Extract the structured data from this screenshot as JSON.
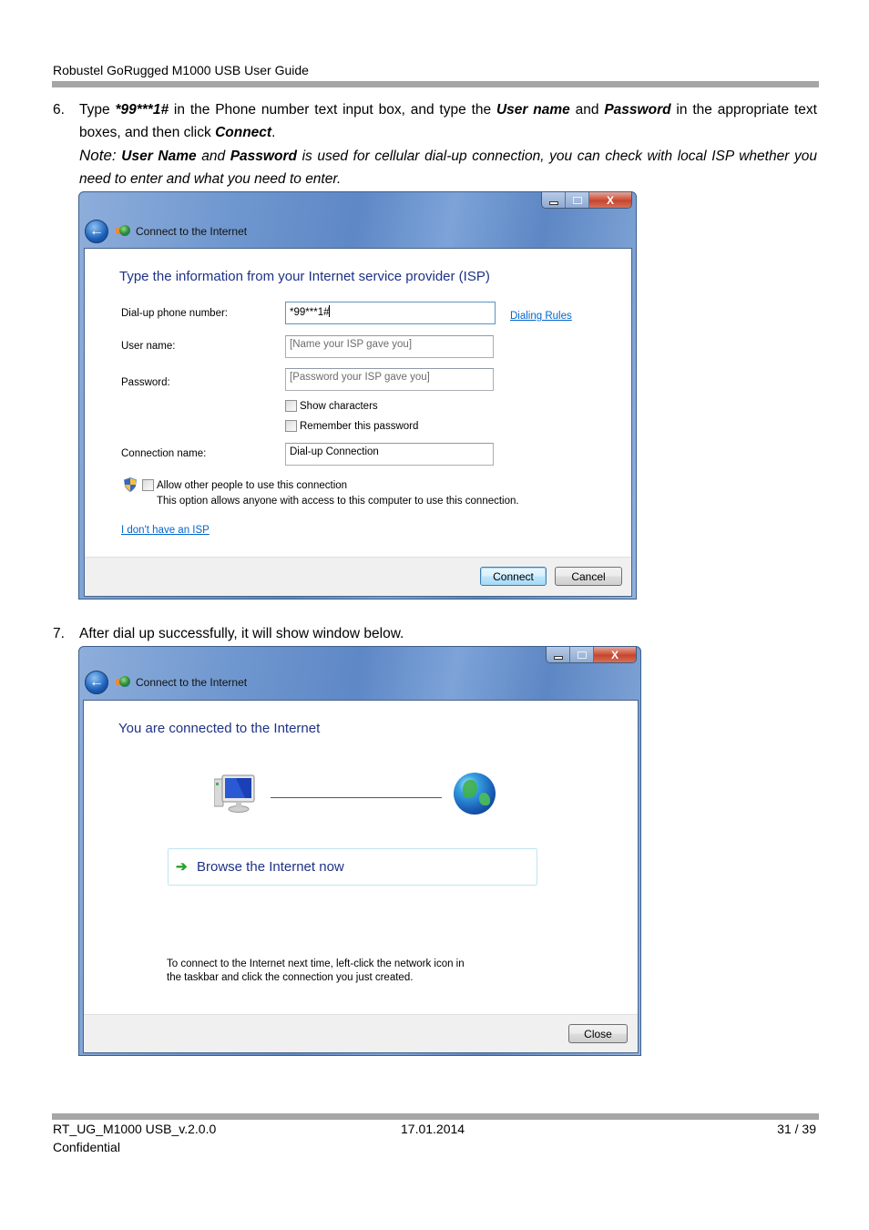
{
  "document": {
    "header": "Robustel GoRugged M1000 USB User Guide",
    "footer": {
      "doc_id": "RT_UG_M1000 USB_v.2.0.0",
      "date": "17.01.2014",
      "page": "31 / 39",
      "classification": "Confidential"
    }
  },
  "steps": {
    "s6": {
      "number": "6.",
      "t1": "Type ",
      "b1": "*99***1#",
      "t2": " in the Phone number text input box, and type the ",
      "b2": "User name",
      "t3": " and ",
      "b3": "Password",
      "t4": " in the appropriate text boxes, and then click ",
      "b4": "Connect",
      "t5": ".",
      "note_label": "Note:",
      "n1": " ",
      "nb1": "User Name",
      "n2": " and ",
      "nb2": "Password",
      "n3": " is used for cellular dial-up connection, you can check with local ISP whether you need to enter and what you need to enter."
    },
    "s7": {
      "number": "7.",
      "text": "After dial up successfully, it will show window below."
    }
  },
  "dialog1": {
    "nav_title": "Connect to the Internet",
    "close_glyph": "X",
    "back_glyph": "←",
    "instruction": "Type the information from your Internet service provider (ISP)",
    "fields": {
      "phone_label": "Dial-up phone number:",
      "phone_value": "*99***1#",
      "dialing_rules": "Dialing Rules",
      "user_label": "User name:",
      "user_placeholder": "[Name your ISP gave you]",
      "password_label": "Password:",
      "password_placeholder": "[Password your ISP gave you]",
      "show_chars": "Show characters",
      "remember_pw": "Remember this password",
      "conn_name_label": "Connection name:",
      "conn_name_value": "Dial-up Connection",
      "allow_others": "Allow other people to use this connection",
      "allow_others_desc": "This option allows anyone with access to this computer to use this connection.",
      "no_isp_link": "I don't have an ISP"
    },
    "buttons": {
      "connect": "Connect",
      "cancel": "Cancel"
    }
  },
  "dialog2": {
    "nav_title": "Connect to the Internet",
    "close_glyph": "X",
    "back_glyph": "←",
    "instruction": "You are connected to the Internet",
    "browse_arrow": "➔",
    "browse_label": "Browse the Internet now",
    "hint_line1": "To connect to the Internet next time, left-click the network icon in",
    "hint_line2": "the taskbar and click the connection you just created.",
    "buttons": {
      "close": "Close"
    }
  }
}
